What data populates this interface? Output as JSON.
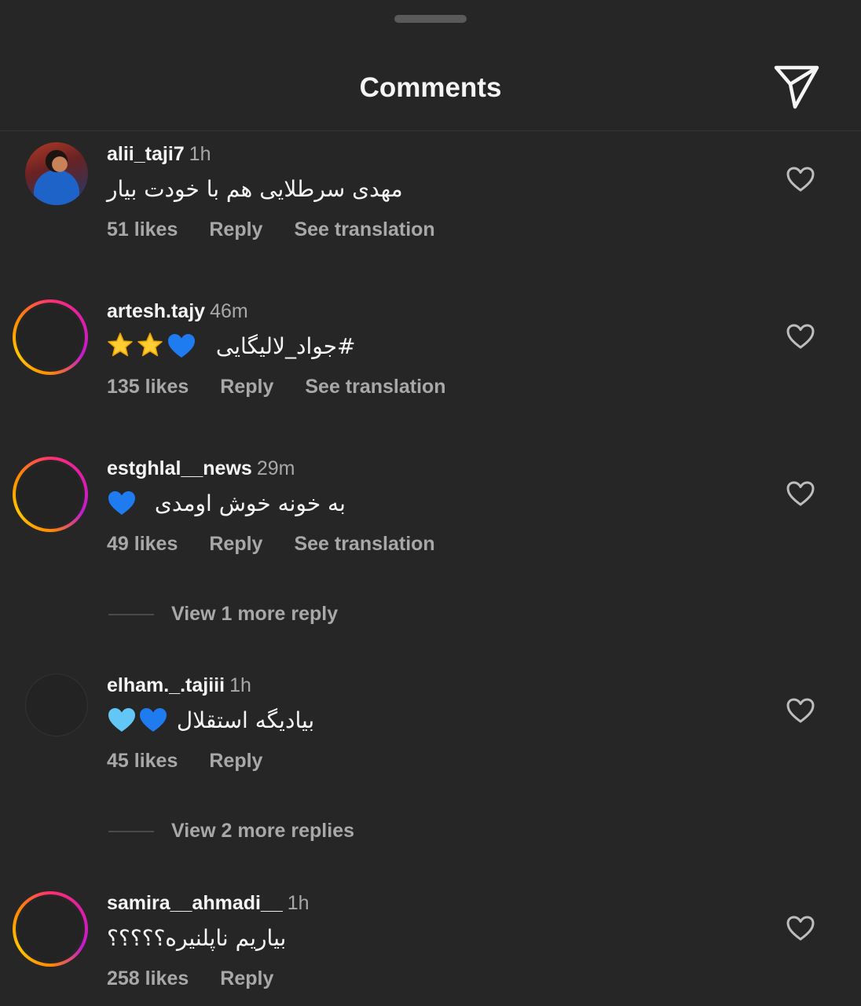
{
  "header": {
    "title": "Comments",
    "share_icon": "paper-plane-icon"
  },
  "comments": [
    {
      "username": "alii_taji7",
      "time": "1h",
      "text": "مهدی سرطلایی هم با خودت بیار",
      "likes": "51 likes",
      "reply": "Reply",
      "translation": "See translation"
    },
    {
      "username": "artesh.tajy",
      "time": "46m",
      "text": "#جواد_لالیگایی",
      "emojis": [
        "star",
        "star",
        "blue-heart"
      ],
      "likes": "135 likes",
      "reply": "Reply",
      "translation": "See translation"
    },
    {
      "username": "estghlal__news",
      "time": "29m",
      "text": "به خونه خوش اومدی",
      "emojis": [
        "blue-heart"
      ],
      "likes": "49 likes",
      "reply": "Reply",
      "translation": "See translation",
      "view_replies": "View 1 more reply"
    },
    {
      "username": "elham._.tajiii",
      "time": "1h",
      "text": "بیادیگه استقلال",
      "emojis": [
        "light-blue-heart",
        "blue-heart"
      ],
      "likes": "45 likes",
      "reply": "Reply",
      "view_replies": "View 2 more replies"
    },
    {
      "username": "samira__ahmadi__",
      "time": "1h",
      "text": "بیاریم ناپلنیره؟؟؟؟؟",
      "likes": "258 likes",
      "reply": "Reply"
    }
  ],
  "colors": {
    "background": "#262626",
    "text_primary": "#f5f5f5",
    "text_secondary": "#a8a8a8",
    "divider": "#363636"
  }
}
